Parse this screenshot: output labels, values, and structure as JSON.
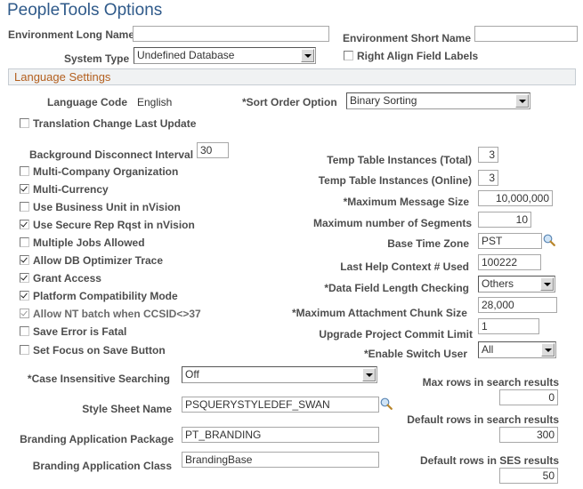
{
  "page": {
    "title": "PeopleTools Options"
  },
  "header": {
    "env_long_name": {
      "label": "Environment Long Name",
      "value": ""
    },
    "env_short_name": {
      "label": "Environment Short Name",
      "value": ""
    },
    "system_type": {
      "label": "System Type",
      "value": "Undefined Database"
    },
    "right_align": {
      "label": "Right Align Field Labels",
      "checked": false
    }
  },
  "section": {
    "title": "Language Settings"
  },
  "language": {
    "code_label": "Language Code",
    "code_value": "English",
    "sort_order": {
      "label": "*Sort Order Option",
      "value": "Binary Sorting"
    },
    "translation_change": {
      "label": "Translation Change Last Update",
      "checked": false
    }
  },
  "bg_disconnect": {
    "label": "Background Disconnect Interval",
    "value": "30"
  },
  "checkboxes": [
    {
      "label": "Multi-Company Organization",
      "checked": false,
      "disabled": false
    },
    {
      "label": "Multi-Currency",
      "checked": true,
      "disabled": false
    },
    {
      "label": "Use Business Unit in nVision",
      "checked": false,
      "disabled": false
    },
    {
      "label": "Use Secure Rep Rqst in nVision",
      "checked": true,
      "disabled": false
    },
    {
      "label": "Multiple Jobs Allowed",
      "checked": false,
      "disabled": false
    },
    {
      "label": "Allow DB Optimizer Trace",
      "checked": true,
      "disabled": false
    },
    {
      "label": "Grant Access",
      "checked": true,
      "disabled": false
    },
    {
      "label": "Platform Compatibility Mode",
      "checked": true,
      "disabled": false
    },
    {
      "label": "Allow NT batch when CCSID<>37",
      "checked": true,
      "disabled": true
    },
    {
      "label": "Save Error is Fatal",
      "checked": false,
      "disabled": false
    },
    {
      "label": "Set Focus on Save Button",
      "checked": false,
      "disabled": false
    }
  ],
  "right_fields": {
    "temp_total": {
      "label": "Temp Table Instances (Total)",
      "value": "3"
    },
    "temp_online": {
      "label": "Temp Table Instances (Online)",
      "value": "3"
    },
    "max_msg_size": {
      "label": "*Maximum Message Size",
      "value": "10,000,000"
    },
    "max_segments": {
      "label": "Maximum number of Segments",
      "value": "10"
    },
    "base_tz": {
      "label": "Base Time Zone",
      "value": "PST"
    },
    "last_help": {
      "label": "Last Help Context # Used",
      "value": "100222"
    },
    "data_field_len": {
      "label": "*Data Field Length Checking",
      "value": "Others"
    },
    "max_attach": {
      "label": "*Maximum Attachment Chunk Size",
      "value": "28,000"
    },
    "upgrade_commit": {
      "label": "Upgrade Project Commit Limit",
      "value": "1"
    },
    "switch_user": {
      "label": "*Enable Switch User",
      "value": "All"
    }
  },
  "bottom": {
    "case_insensitive": {
      "label": "*Case Insensitive Searching",
      "value": "Off"
    },
    "style_sheet": {
      "label": "Style Sheet Name",
      "value": "PSQUERYSTYLEDEF_SWAN"
    },
    "branding_pkg": {
      "label": "Branding Application Package",
      "value": "PT_BRANDING"
    },
    "branding_class": {
      "label": "Branding Application Class",
      "value": "BrandingBase"
    },
    "max_rows": {
      "label": "Max rows in search results",
      "value": "0"
    },
    "default_rows": {
      "label": "Default rows in search results",
      "value": "300"
    },
    "ses_rows": {
      "label": "Default rows in SES results",
      "value": "50"
    }
  },
  "icons": {
    "lookup": "magnifier-icon",
    "dropdown": "chevron-down-icon"
  }
}
